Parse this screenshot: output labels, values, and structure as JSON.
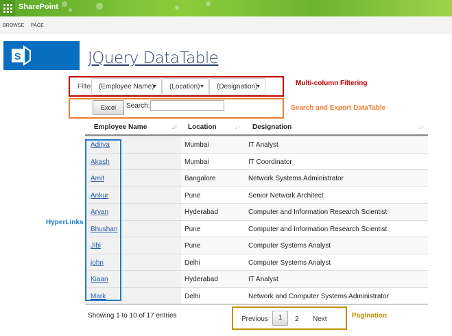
{
  "topbar": {
    "brand": "SharePoint"
  },
  "nav": [
    "BROWSE",
    "PAGE"
  ],
  "page": {
    "title": "JQuery DataTable"
  },
  "filter": {
    "label": "Filter",
    "selects": [
      "(Employee Name)",
      "(Location)",
      "(Designation)"
    ]
  },
  "toolbar": {
    "excel": "Excel",
    "search_label": "Search:",
    "search_value": ""
  },
  "annotations": {
    "filtering": "Multi-column Filtering",
    "search_export": "Search and Export DataTable",
    "hyperlinks": "HyperLinks",
    "pagination": "Pagination"
  },
  "table": {
    "headers": [
      "Employee Name",
      "Location",
      "Designation"
    ],
    "rows": [
      [
        "Aditya",
        "Mumbai",
        "IT Analyst"
      ],
      [
        "Akash",
        "Mumbai",
        "IT Coordinator"
      ],
      [
        "Amit",
        "Bangalore",
        "Network Systems Administrator"
      ],
      [
        "Ankur",
        "Pune",
        "Senior Network Architect"
      ],
      [
        "Aryan",
        "Hyderabad",
        "Computer and Information Research Scientist"
      ],
      [
        "Bhushan",
        "Pune",
        "Computer and Information Research Scientist"
      ],
      [
        "Jibi",
        "Pune",
        "Computer Systems Analyst"
      ],
      [
        "john",
        "Delhi",
        "Computer Systems Analyst"
      ],
      [
        "Kiaan",
        "Hyderabad",
        "IT Analyst"
      ],
      [
        "Mark",
        "Delhi",
        "Network and Computer Systems Administrator"
      ]
    ]
  },
  "footer": {
    "info": "Showing 1 to 10 of 17 entries",
    "previous": "Previous",
    "pages": [
      "1",
      "2"
    ],
    "next": "Next",
    "current_page": 1
  },
  "colors": {
    "filter_box": "#c00000",
    "search_box": "#ed7d31",
    "hyperlink_box": "#1f7ac7",
    "pagination_box": "#bf9000"
  }
}
